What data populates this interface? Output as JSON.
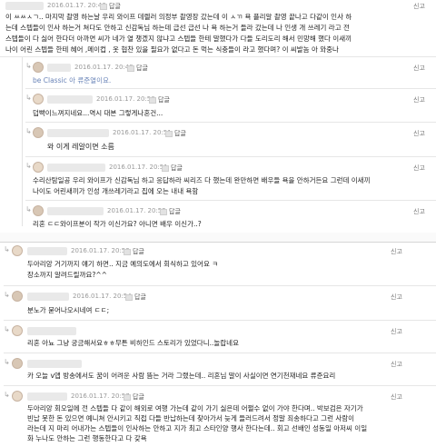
{
  "common": {
    "reply_label": "답글",
    "report_label": "신고"
  },
  "comments": [
    {
      "date": "2016.01.17. 20:46",
      "text": [
        "이 ㅆㅆㅅㄱ.. 마지막 촬영 하는날 우리 와이프 데렐러 의정부 촬영장 갔는데 이 ㅅㄲ 욕 플리알 촬영 끝나고 다같이 인사 하",
        "는데 스텝들이 인사 하는거 쳐다도 안하고 신감독님 하는데 급선 급선 나 욕 하는거 들라 갔는데 나 인생 개 쓰레기 라고 전",
        "스텝들이 다 싫어 한다더 아까면 씨가 네가 열 챙겠지 않냐고 스텝들 한테 말했다가 다들 도리도리 해서 민망해 했다 이새끼",
        "나이 어린 스텝들 한테 혜어 ,메이컵 , 옷 협찬 있을 필요가 없다고 돈 먹는 식충들이 라고 했다며? 이 씨발놈 아 와중나"
      ]
    },
    {
      "date": "2016.01.17. 20:49",
      "text": [
        "be Classic 아 류준열이요."
      ]
    },
    {
      "date": "2016.01.17. 20:50",
      "text": [
        "덥빡이느껴지네요...역시 대본 그렇게나혼건..."
      ]
    },
    {
      "date": "2016.01.17. 20:51",
      "text": [
        "와 이게 레알이면 소름"
      ]
    },
    {
      "date": "2016.01.17. 20:51",
      "text": [
        "수리산탐일공 우리 와이프가 신감독님 하고 응답하라 씨리즈 다 했는데 완만하면 배우들 욕을 안하거든요 그런데 이새끼",
        "나이도 어린새끼가 인성 개쓰레기라고 집에 오는 내내 욕함"
      ]
    },
    {
      "date": "2016.01.17. 20:52",
      "text": [
        "리혼 ㄷㄷ와이프분이 작가 이신가요? 아니면 배우 이신가..?"
      ]
    },
    {
      "date": "2016.01.17. 20:53",
      "text": [
        "두아리앙 거기까지 얘기 하면.. 지금 예의도에서 회식하고 있어요 ㅋ",
        "장소까지 알려드릴까요?^^"
      ]
    },
    {
      "date": "2016.01.17. 20:54",
      "text": [
        "분노가 묻어나오시네여 ㄷㄷ;"
      ]
    },
    {
      "date": "",
      "text": [
        "리혼 아뇨 그냥 궁금해서요ㅎㅎ무튼 비하인드 스토리가 있었다니..놀랍네요"
      ]
    },
    {
      "date": "",
      "text": [
        "카 오늘 v앱 방송에서도 꿈이 어려운 사람 뜸는 거라 그랬는데.. 리혼님 말이 사실이면 연기천재네요 류준요리"
      ]
    },
    {
      "date": "2016.01.17. 20:57",
      "text": [
        "두아리앙 회오일에 전 스텝들 다 같이 해외로 여행 가는데 같이 가기 싫은데 어쩔수 없이 가야 한다며.. 박보검은 자기가",
        "빈납 못한 돈 있으면 예니쳐 안시키고 직접 다들 반납하는데 찾아가서 늦게 들러드려서 정말 죄송하다고 그런 사람이",
        "라는데 지 마리 어내가는 스텝들이 인사하는 안하고 지가 최고 스타인양 행사 한다는데.. 회고 선배인 성동일 아저씨 이일",
        "화 누나도 안하는 그런 행동한다고 다 갖욕"
      ]
    }
  ]
}
